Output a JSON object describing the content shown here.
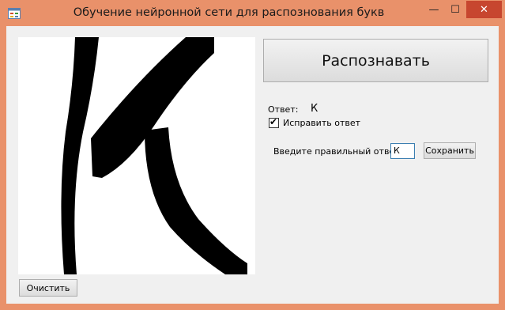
{
  "window": {
    "title": "Обучение нейронной сети для распознования букв",
    "icon": "app-form-icon",
    "controls": {
      "minimize": "—",
      "maximize": "☐",
      "close": "✕"
    },
    "close_color": "#c7462f",
    "frame_color": "#e9916a"
  },
  "canvas": {
    "drawn_letter": "К",
    "ink_color": "#000000"
  },
  "recognize_button": {
    "label": "Распознавать"
  },
  "result": {
    "answer_label": "Ответ:",
    "answer_value": "К"
  },
  "fix_answer": {
    "label": "Исправить ответ",
    "checked": true
  },
  "correction": {
    "prompt_label": "Введите правильный ответ",
    "input_value": "К",
    "save_label": "Сохранить"
  },
  "clear_button": {
    "label": "Очистить"
  }
}
